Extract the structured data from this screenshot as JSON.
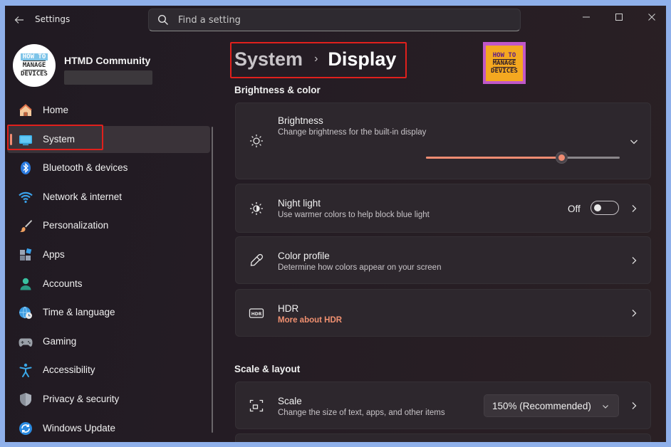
{
  "window": {
    "app_title": "Settings",
    "search_placeholder": "Find a setting"
  },
  "profile": {
    "name": "HTMD Community",
    "avatar_text": [
      "HOW TO",
      "MANAGE",
      "DEVICES"
    ]
  },
  "logo": {
    "text": [
      "HOW TO",
      "MANAGE",
      "DEVICES"
    ]
  },
  "sidebar": {
    "items": [
      {
        "label": "Home",
        "icon": "home-icon",
        "active": false
      },
      {
        "label": "System",
        "icon": "system-icon",
        "active": true
      },
      {
        "label": "Bluetooth & devices",
        "icon": "bluetooth-icon",
        "active": false
      },
      {
        "label": "Network & internet",
        "icon": "wifi-icon",
        "active": false
      },
      {
        "label": "Personalization",
        "icon": "brush-icon",
        "active": false
      },
      {
        "label": "Apps",
        "icon": "apps-icon",
        "active": false
      },
      {
        "label": "Accounts",
        "icon": "person-icon",
        "active": false
      },
      {
        "label": "Time & language",
        "icon": "globe-clock-icon",
        "active": false
      },
      {
        "label": "Gaming",
        "icon": "gamepad-icon",
        "active": false
      },
      {
        "label": "Accessibility",
        "icon": "accessibility-icon",
        "active": false
      },
      {
        "label": "Privacy & security",
        "icon": "shield-icon",
        "active": false
      },
      {
        "label": "Windows Update",
        "icon": "update-icon",
        "active": false
      }
    ]
  },
  "breadcrumb": {
    "parent": "System",
    "separator": "›",
    "current": "Display"
  },
  "sections": {
    "brightness_color": "Brightness & color",
    "scale_layout": "Scale & layout"
  },
  "brightness": {
    "title": "Brightness",
    "description": "Change brightness for the built-in display",
    "value_fraction": 0.7
  },
  "night_light": {
    "title": "Night light",
    "description": "Use warmer colors to help block blue light",
    "state_label": "Off"
  },
  "color_profile": {
    "title": "Color profile",
    "description": "Determine how colors appear on your screen"
  },
  "hdr": {
    "title": "HDR",
    "link": "More about HDR"
  },
  "scale": {
    "title": "Scale",
    "description": "Change the size of text, apps, and other items",
    "selected": "150% (Recommended)"
  },
  "colors": {
    "accent": "#f08c72",
    "highlight_box": "#e0201c"
  }
}
